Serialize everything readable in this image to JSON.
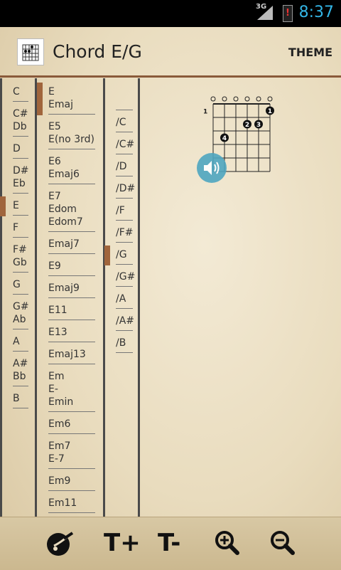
{
  "status": {
    "network": "3G",
    "time": "8:37"
  },
  "header": {
    "title": "Chord E/G",
    "theme_label": "THEME"
  },
  "roots": [
    [
      "C"
    ],
    [
      "C#",
      "Db"
    ],
    [
      "D"
    ],
    [
      "D#",
      "Eb"
    ],
    [
      "E"
    ],
    [
      "F"
    ],
    [
      "F#",
      "Gb"
    ],
    [
      "G"
    ],
    [
      "G#",
      "Ab"
    ],
    [
      "A"
    ],
    [
      "A#",
      "Bb"
    ],
    [
      "B"
    ]
  ],
  "types": [
    [
      "E",
      "Emaj"
    ],
    [
      "E5",
      "E(no 3rd)"
    ],
    [
      "E6",
      "Emaj6"
    ],
    [
      "E7",
      "Edom",
      "Edom7"
    ],
    [
      "Emaj7"
    ],
    [
      "E9"
    ],
    [
      "Emaj9"
    ],
    [
      "E11"
    ],
    [
      "E13"
    ],
    [
      "Emaj13"
    ],
    [
      "Em",
      "E-",
      "Emin"
    ],
    [
      "Em6"
    ],
    [
      "Em7",
      "E-7"
    ],
    [
      "Em9"
    ],
    [
      "Em11"
    ]
  ],
  "bass": [
    "",
    "/C",
    "/C#",
    "/D",
    "/D#",
    "/F",
    "/F#",
    "/G",
    "/G#",
    "/A",
    "/A#",
    "/B"
  ],
  "chord_diagram": {
    "start_fret": "1",
    "open_strings": [
      true,
      true,
      true,
      true,
      true,
      true
    ],
    "dots": [
      {
        "string": 5,
        "fret": 1,
        "finger": "1"
      },
      {
        "string": 3,
        "fret": 2,
        "finger": "2"
      },
      {
        "string": 4,
        "fret": 2,
        "finger": "3"
      },
      {
        "string": 1,
        "fret": 3,
        "finger": "4"
      }
    ]
  },
  "selected": {
    "root_index": 4,
    "type_index": 0,
    "bass_index": 7
  },
  "toolbar": {
    "items": [
      {
        "name": "guitar-icon",
        "glyph": ""
      },
      {
        "name": "text-size-increase-icon",
        "glyph": "T+"
      },
      {
        "name": "text-size-decrease-icon",
        "glyph": "T-"
      },
      {
        "name": "zoom-in-icon",
        "glyph": ""
      },
      {
        "name": "zoom-out-icon",
        "glyph": ""
      }
    ]
  }
}
